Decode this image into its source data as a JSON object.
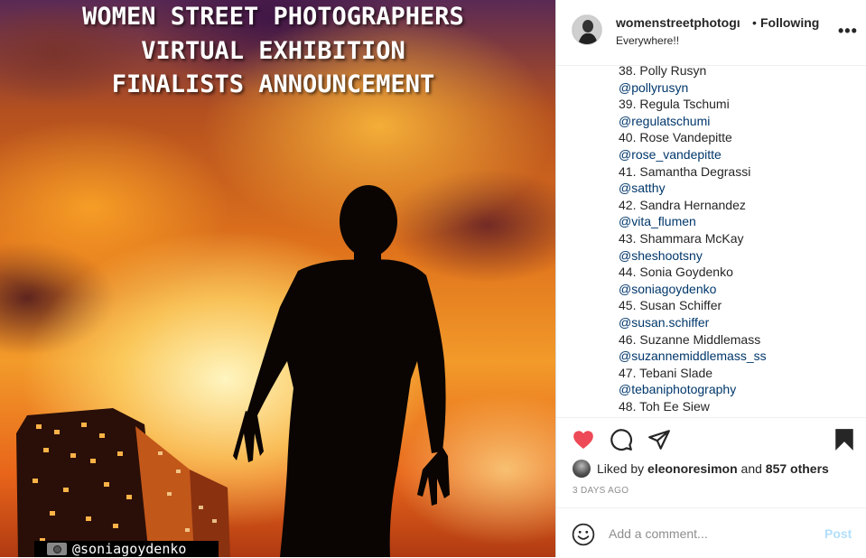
{
  "photo": {
    "title_lines": [
      "WOMEN STREET PHOTOGRAPHERS",
      "VIRTUAL EXHIBITION",
      "FINALISTS ANNOUNCEMENT"
    ],
    "watermark": "@soniagoydenko"
  },
  "header": {
    "username": "womenstreetphotogı",
    "separator": "•",
    "follow_status": "Following",
    "location": "Everywhere!!",
    "more_icon": "more-horizontal-icon"
  },
  "caption": {
    "lines": [
      {
        "text": "38. Polly Rusyn",
        "type": "name"
      },
      {
        "text": "@pollyrusyn",
        "type": "handle"
      },
      {
        "text": "39. Regula Tschumi",
        "type": "name"
      },
      {
        "text": "@regulatschumi",
        "type": "handle"
      },
      {
        "text": "40. Rose Vandepitte",
        "type": "name"
      },
      {
        "text": "@rose_vandepitte",
        "type": "handle"
      },
      {
        "text": "41. Samantha Degrassi",
        "type": "name"
      },
      {
        "text": "@satthy",
        "type": "handle"
      },
      {
        "text": "42. Sandra Hernandez",
        "type": "name"
      },
      {
        "text": "@vita_flumen",
        "type": "handle"
      },
      {
        "text": "43. Shammara McKay",
        "type": "name"
      },
      {
        "text": "@sheshootsny",
        "type": "handle"
      },
      {
        "text": "44. Sonia Goydenko",
        "type": "name"
      },
      {
        "text": "@soniagoydenko",
        "type": "handle"
      },
      {
        "text": "45. Susan Schiffer",
        "type": "name"
      },
      {
        "text": "@susan.schiffer",
        "type": "handle"
      },
      {
        "text": "46. Suzanne Middlemass",
        "type": "name"
      },
      {
        "text": "@suzannemiddlemass_ss",
        "type": "handle"
      },
      {
        "text": "47. Tebani Slade",
        "type": "name"
      },
      {
        "text": "@tebaniphotography",
        "type": "handle"
      },
      {
        "text": "48. Toh Ee Siew",
        "type": "name"
      }
    ]
  },
  "actions": {
    "like_icon": "heart-icon",
    "comment_icon": "comment-icon",
    "share_icon": "share-icon",
    "save_icon": "bookmark-icon",
    "like_color": "#ed4956"
  },
  "likes": {
    "prefix": "Liked by",
    "user": "eleonoresimon",
    "and": "and",
    "count": "857 others"
  },
  "timestamp": "3 DAYS AGO",
  "comment": {
    "emoji_icon": "emoji-icon",
    "placeholder": "Add a comment...",
    "post_label": "Post"
  }
}
